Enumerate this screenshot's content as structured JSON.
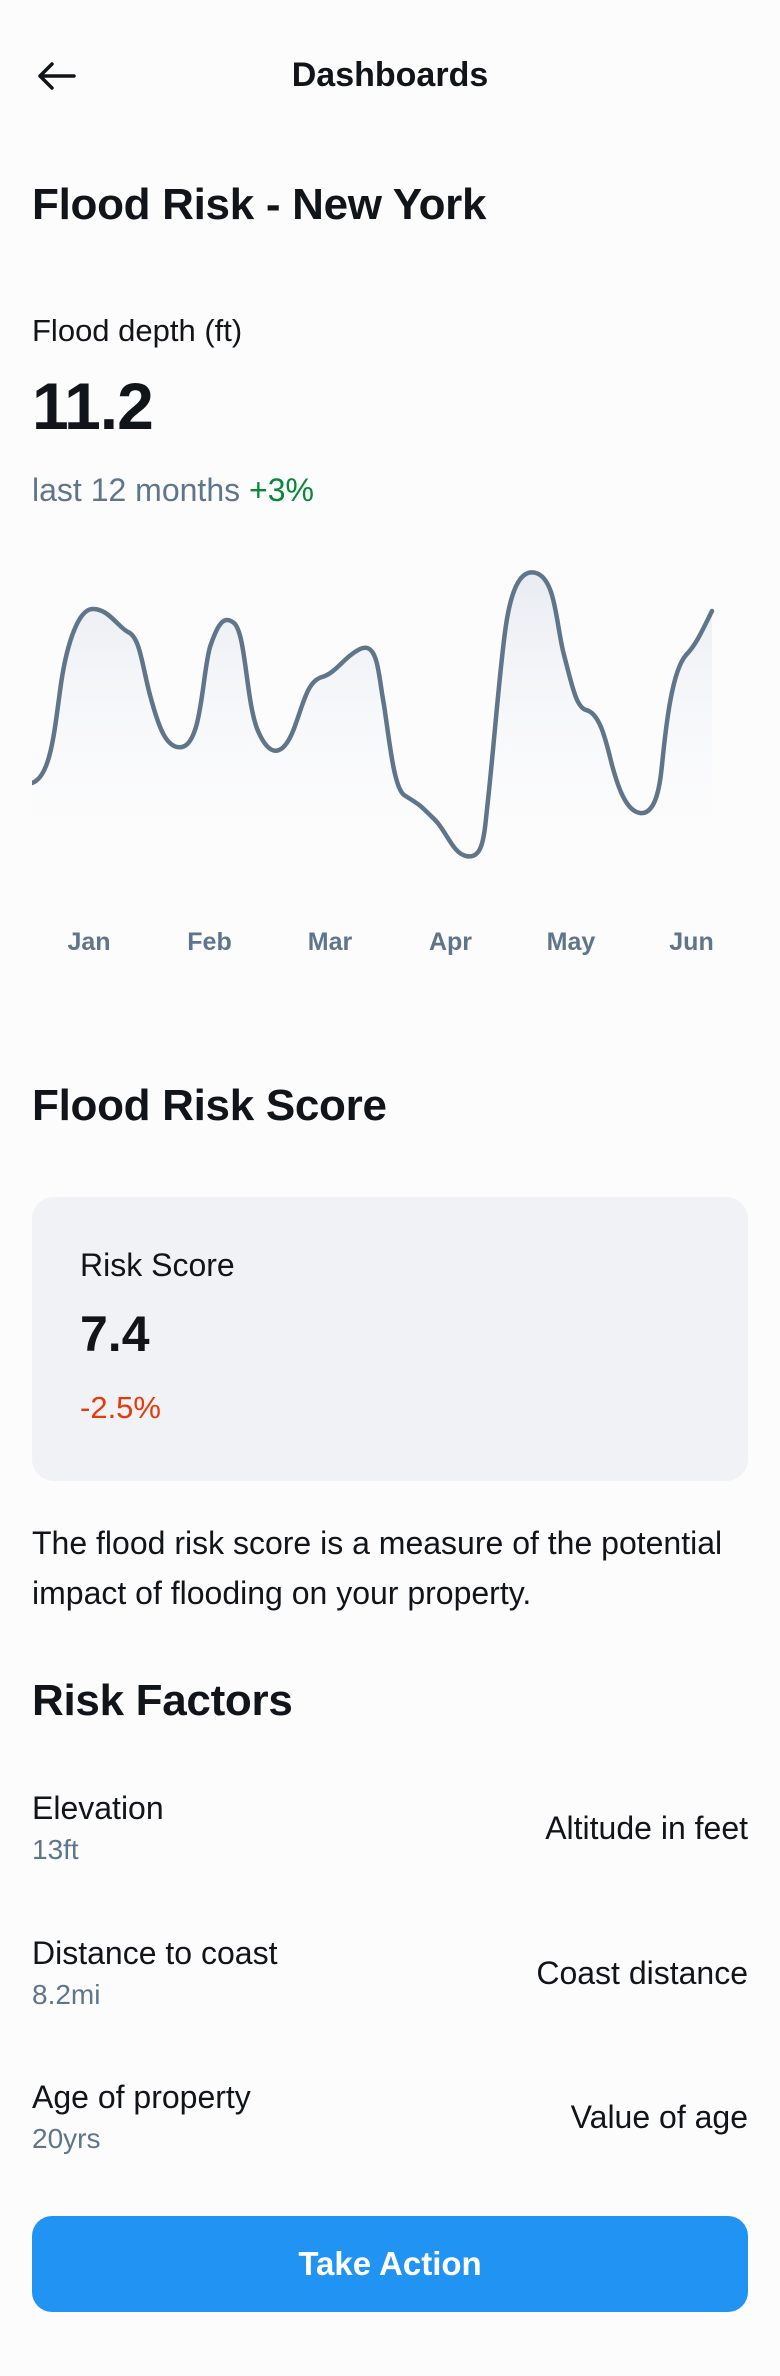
{
  "header": {
    "back_icon": "arrow-left-icon",
    "title": "Dashboards"
  },
  "page_title": "Flood Risk - New York",
  "metric": {
    "label": "Flood depth (ft)",
    "value": "11.2",
    "period": "last 12 months",
    "change": "+3%"
  },
  "chart_data": {
    "type": "area",
    "title": "",
    "xlabel": "",
    "ylabel": "",
    "x_ticks": [
      "Jan",
      "Feb",
      "Mar",
      "Apr",
      "May",
      "Jun"
    ],
    "grid": false,
    "legend": "none",
    "color": "#60758a"
  },
  "risk_score": {
    "section_title": "Flood Risk Score",
    "label": "Risk Score",
    "value": "7.4",
    "change": "-2.5%"
  },
  "description": "The flood risk score is a measure of the potential impact of flooding on your property.",
  "risk_factors": {
    "section_title": "Risk Factors",
    "items": [
      {
        "name": "Elevation",
        "value": "13ft",
        "detail": "Altitude in feet"
      },
      {
        "name": "Distance to coast",
        "value": "8.2mi",
        "detail": "Coast distance"
      },
      {
        "name": "Age of property",
        "value": "20yrs",
        "detail": "Value of age"
      }
    ]
  },
  "cta": {
    "label": "Take Action"
  },
  "colors": {
    "accent": "#2194f3",
    "positive": "#078838",
    "negative": "#e73908",
    "muted": "#60758a",
    "card_bg": "#f0f2f5"
  }
}
